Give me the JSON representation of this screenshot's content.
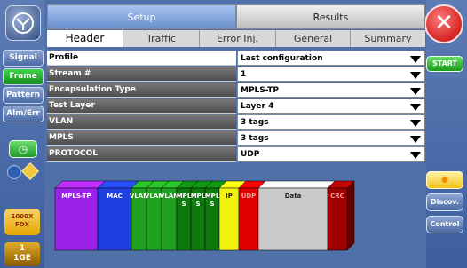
{
  "left_nav": {
    "tabs": [
      {
        "label": "Signal",
        "selected": false
      },
      {
        "label": "Frame",
        "selected": true
      },
      {
        "label": "Pattern",
        "selected": false
      },
      {
        "label": "Alm/Err",
        "selected": false
      }
    ],
    "link_badge": [
      "1000X",
      "FDX"
    ],
    "port_badge": [
      "1",
      "1GE"
    ]
  },
  "right_nav": {
    "start_label": "START",
    "discover_label": "Discov.",
    "control_label": "Control"
  },
  "top_tabs": [
    {
      "label": "Setup",
      "selected": true
    },
    {
      "label": "Results",
      "selected": false
    }
  ],
  "sub_tabs": [
    {
      "label": "Header",
      "selected": true
    },
    {
      "label": "Traffic",
      "selected": false
    },
    {
      "label": "Error Inj.",
      "selected": false
    },
    {
      "label": "General",
      "selected": false
    },
    {
      "label": "Summary",
      "selected": false
    }
  ],
  "settings": [
    {
      "label": "Profile",
      "value": "Last configuration"
    },
    {
      "label": "Stream #",
      "value": "1"
    },
    {
      "label": "Encapsulation Type",
      "value": "MPLS-TP"
    },
    {
      "label": "Test Layer",
      "value": "Layer 4"
    },
    {
      "label": "VLAN",
      "value": "3 tags"
    },
    {
      "label": "MPLS",
      "value": "3 tags"
    },
    {
      "label": "PROTOCOL",
      "value": "UDP"
    }
  ],
  "frame_blocks": [
    {
      "label": "MPLS-TP",
      "color": "#9a22e8"
    },
    {
      "label": "MAC",
      "color": "#1f3fe0"
    },
    {
      "label": "VLAN",
      "color": "#1fa01f"
    },
    {
      "label": "VLAN",
      "color": "#1fa01f"
    },
    {
      "label": "VLAN",
      "color": "#1fa01f"
    },
    {
      "label": "MPL S",
      "color": "#0e7a0e"
    },
    {
      "label": "MPL S",
      "color": "#0e7a0e"
    },
    {
      "label": "MPL S",
      "color": "#0e7a0e"
    },
    {
      "label": "IP",
      "color": "#f2f20f"
    },
    {
      "label": "UDP",
      "color": "#e00000"
    },
    {
      "label": "Data",
      "color": "#c9c9c9"
    },
    {
      "label": "CRC",
      "color": "#a00000"
    }
  ]
}
